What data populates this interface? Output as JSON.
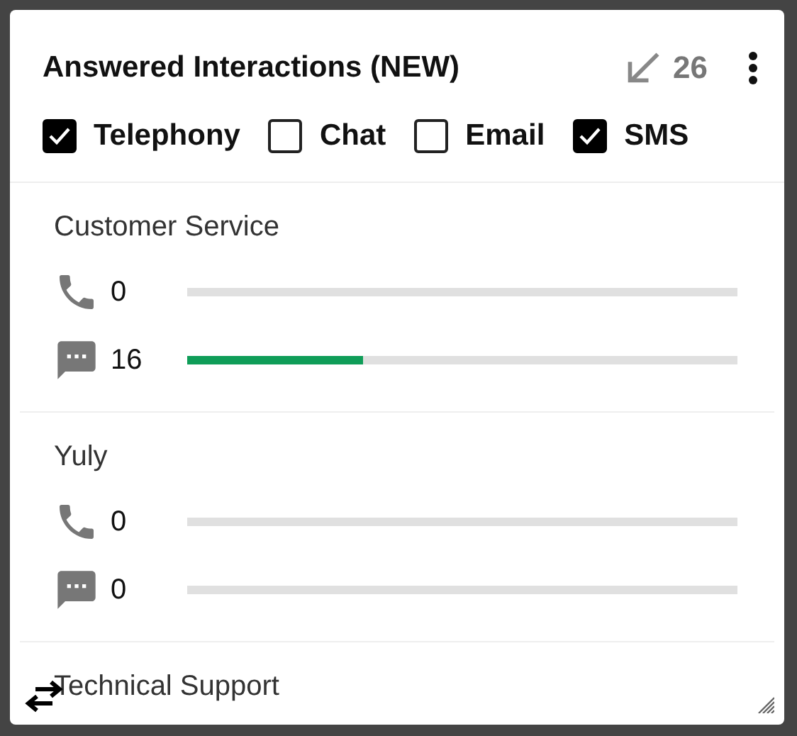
{
  "widget": {
    "title": "Answered Interactions (NEW)",
    "total": "26"
  },
  "filters": [
    {
      "label": "Telephony",
      "checked": true
    },
    {
      "label": "Chat",
      "checked": false
    },
    {
      "label": "Email",
      "checked": false
    },
    {
      "label": "SMS",
      "checked": true
    }
  ],
  "groups": [
    {
      "name": "Customer Service",
      "rows": [
        {
          "kind": "phone",
          "count": "0",
          "level": 0
        },
        {
          "kind": "chat",
          "count": "16",
          "level": 0.32
        }
      ]
    },
    {
      "name": "Yuly",
      "rows": [
        {
          "kind": "phone",
          "count": "0",
          "level": 0
        },
        {
          "kind": "chat",
          "count": "0",
          "level": 0
        }
      ]
    },
    {
      "name": "Technical Support"
    }
  ]
}
